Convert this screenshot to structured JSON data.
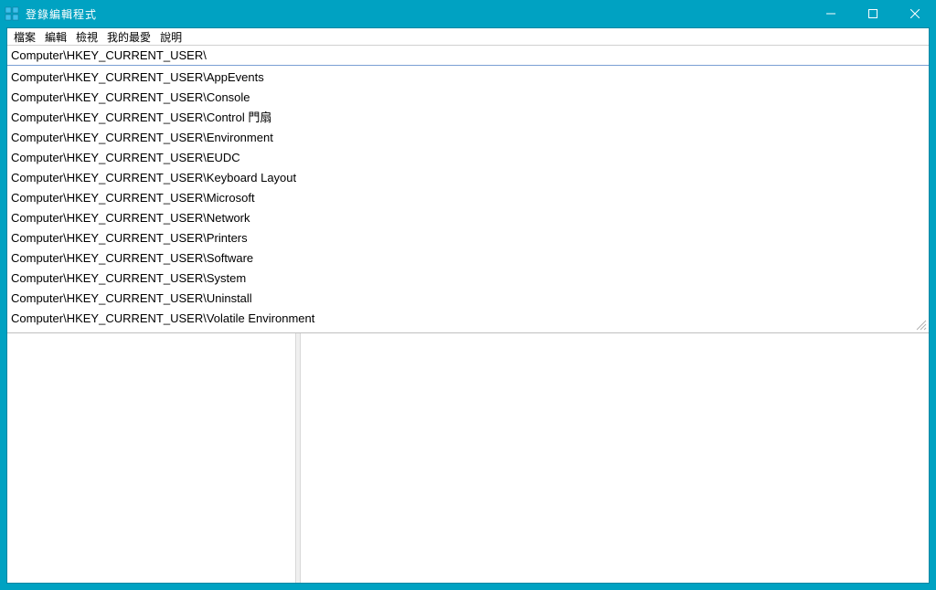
{
  "window": {
    "title": "登錄編輯程式"
  },
  "menubar": {
    "items": [
      "檔案",
      "編輯",
      "檢視",
      "我的最愛",
      "說明"
    ]
  },
  "addressbar": {
    "value": "Computer\\HKEY_CURRENT_USER\\"
  },
  "autocomplete": {
    "items": [
      "Computer\\HKEY_CURRENT_USER\\AppEvents",
      "Computer\\HKEY_CURRENT_USER\\Console",
      "Computer\\HKEY_CURRENT_USER\\Control 門扇",
      "Computer\\HKEY_CURRENT_USER\\Environment",
      "Computer\\HKEY_CURRENT_USER\\EUDC",
      "Computer\\HKEY_CURRENT_USER\\Keyboard Layout",
      "Computer\\HKEY_CURRENT_USER\\Microsoft",
      "Computer\\HKEY_CURRENT_USER\\Network",
      "Computer\\HKEY_CURRENT_USER\\Printers",
      "Computer\\HKEY_CURRENT_USER\\Software",
      "Computer\\HKEY_CURRENT_USER\\System",
      "Computer\\HKEY_CURRENT_USER\\Uninstall",
      "Computer\\HKEY_CURRENT_USER\\Volatile Environment"
    ]
  }
}
